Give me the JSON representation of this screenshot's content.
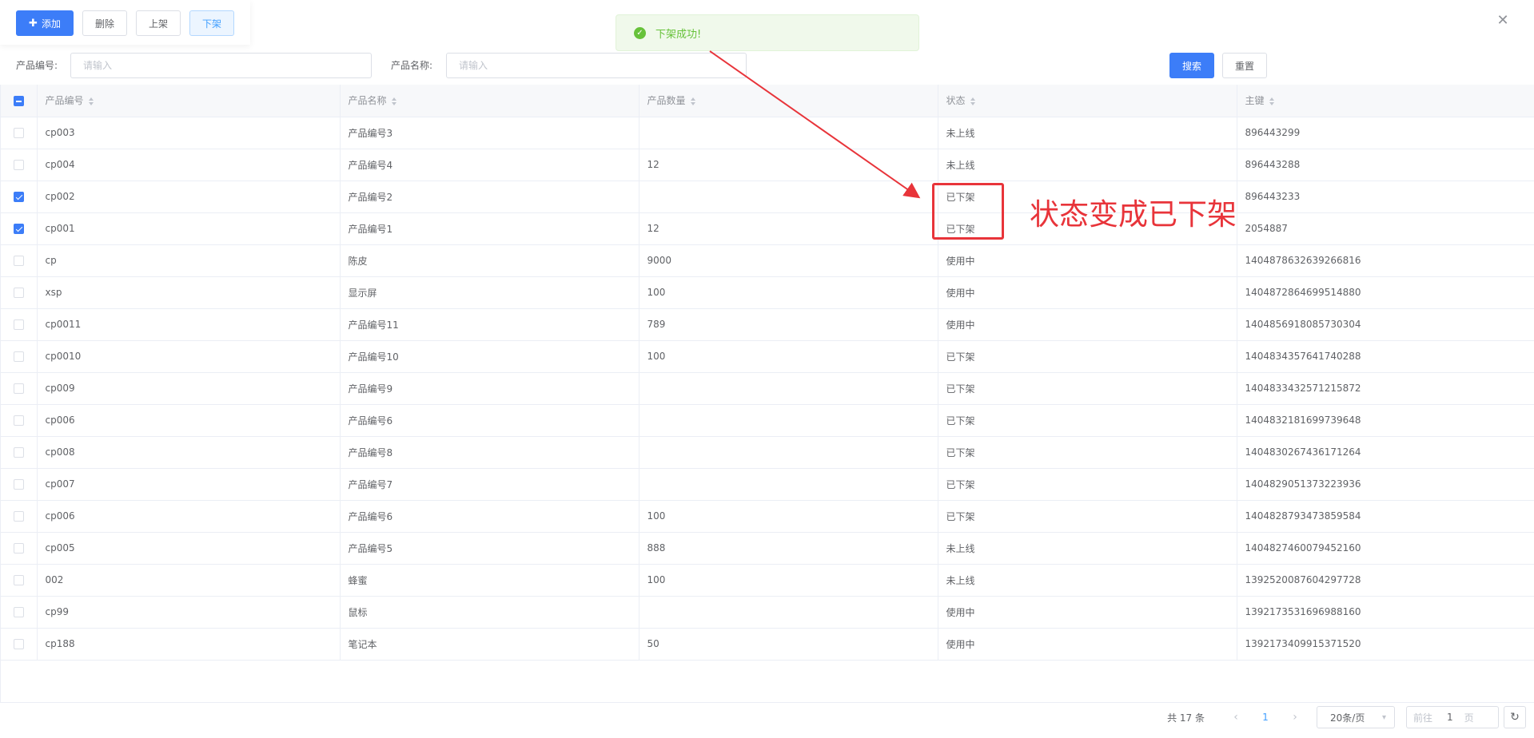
{
  "toolbar": {
    "add_label": "添加",
    "delete_label": "删除",
    "shelve_label": "上架",
    "unshelve_label": "下架"
  },
  "toast": {
    "message": "下架成功!"
  },
  "search": {
    "code_label": "产品编号:",
    "code_placeholder": "请输入",
    "name_label": "产品名称:",
    "name_placeholder": "请输入",
    "search_label": "搜索",
    "reset_label": "重置"
  },
  "table": {
    "columns": [
      "产品编号",
      "产品名称",
      "产品数量",
      "状态",
      "主键"
    ],
    "rows": [
      {
        "checked": false,
        "code": "cp003",
        "name": "产品编号3",
        "qty": "",
        "status": "未上线",
        "key": "896443299"
      },
      {
        "checked": false,
        "code": "cp004",
        "name": "产品编号4",
        "qty": "12",
        "status": "未上线",
        "key": "896443288"
      },
      {
        "checked": true,
        "code": "cp002",
        "name": "产品编号2",
        "qty": "",
        "status": "已下架",
        "key": "896443233"
      },
      {
        "checked": true,
        "code": "cp001",
        "name": "产品编号1",
        "qty": "12",
        "status": "已下架",
        "key": "2054887"
      },
      {
        "checked": false,
        "code": "cp",
        "name": "陈皮",
        "qty": "9000",
        "status": "使用中",
        "key": "1404878632639266816"
      },
      {
        "checked": false,
        "code": "xsp",
        "name": "显示屏",
        "qty": "100",
        "status": "使用中",
        "key": "1404872864699514880"
      },
      {
        "checked": false,
        "code": "cp0011",
        "name": "产品编号11",
        "qty": "789",
        "status": "使用中",
        "key": "1404856918085730304"
      },
      {
        "checked": false,
        "code": "cp0010",
        "name": "产品编号10",
        "qty": "100",
        "status": "已下架",
        "key": "1404834357641740288"
      },
      {
        "checked": false,
        "code": "cp009",
        "name": "产品编号9",
        "qty": "",
        "status": "已下架",
        "key": "1404833432571215872"
      },
      {
        "checked": false,
        "code": "cp006",
        "name": "产品编号6",
        "qty": "",
        "status": "已下架",
        "key": "1404832181699739648"
      },
      {
        "checked": false,
        "code": "cp008",
        "name": "产品编号8",
        "qty": "",
        "status": "已下架",
        "key": "1404830267436171264"
      },
      {
        "checked": false,
        "code": "cp007",
        "name": "产品编号7",
        "qty": "",
        "status": "已下架",
        "key": "1404829051373223936"
      },
      {
        "checked": false,
        "code": "cp006",
        "name": "产品编号6",
        "qty": "100",
        "status": "已下架",
        "key": "1404828793473859584"
      },
      {
        "checked": false,
        "code": "cp005",
        "name": "产品编号5",
        "qty": "888",
        "status": "未上线",
        "key": "1404827460079452160"
      },
      {
        "checked": false,
        "code": "002",
        "name": "蜂蜜",
        "qty": "100",
        "status": "未上线",
        "key": "1392520087604297728"
      },
      {
        "checked": false,
        "code": "cp99",
        "name": "鼠标",
        "qty": "",
        "status": "使用中",
        "key": "1392173531696988160"
      },
      {
        "checked": false,
        "code": "cp188",
        "name": "笔记本",
        "qty": "50",
        "status": "使用中",
        "key": "1392173409915371520"
      }
    ]
  },
  "annotation": {
    "text": "状态变成已下架",
    "color": "#e8343a"
  },
  "pagination": {
    "total_text": "共 17 条",
    "current_page": "1",
    "page_size": "20条/页",
    "goto_prefix": "前往",
    "goto_value": "1",
    "goto_suffix": "页"
  },
  "colors": {
    "primary": "#3c7df8",
    "success": "#67c23a"
  }
}
